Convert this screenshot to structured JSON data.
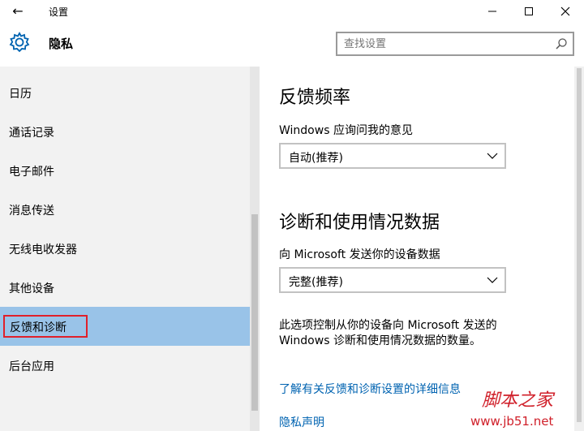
{
  "window": {
    "app_title": "设置",
    "back_glyph": "←",
    "minimize_icon": "minimize-icon",
    "maximize_icon": "maximize-icon",
    "close_icon": "close-icon"
  },
  "header": {
    "icon": "gear-icon",
    "title": "隐私",
    "search_placeholder": "查找设置"
  },
  "sidebar": {
    "items": [
      {
        "label": "日历"
      },
      {
        "label": "通话记录"
      },
      {
        "label": "电子邮件"
      },
      {
        "label": "消息传送"
      },
      {
        "label": "无线电收发器"
      },
      {
        "label": "其他设备"
      },
      {
        "label": "反馈和诊断",
        "selected": true
      },
      {
        "label": "后台应用"
      }
    ]
  },
  "main": {
    "section1": {
      "heading": "反馈频率",
      "label": "Windows 应询问我的意见",
      "dropdown_value": "自动(推荐)"
    },
    "section2": {
      "heading": "诊断和使用情况数据",
      "label": "向 Microsoft 发送你的设备数据",
      "dropdown_value": "完整(推荐)",
      "description_line1": "此选项控制从你的设备向 Microsoft 发送的",
      "description_line2": "Windows 诊断和使用情况数据的数量。"
    },
    "links": {
      "learn_more": "了解有关反馈和诊断设置的详细信息",
      "privacy_statement": "隐私声明"
    }
  },
  "watermark": {
    "line1": "脚本之家",
    "line2": "www.jb51.net"
  },
  "colors": {
    "sidebar_bg": "#f2f2f2",
    "selected_bg": "#99c3e8",
    "selection_outline": "#e0202a",
    "link": "#0063b1"
  }
}
